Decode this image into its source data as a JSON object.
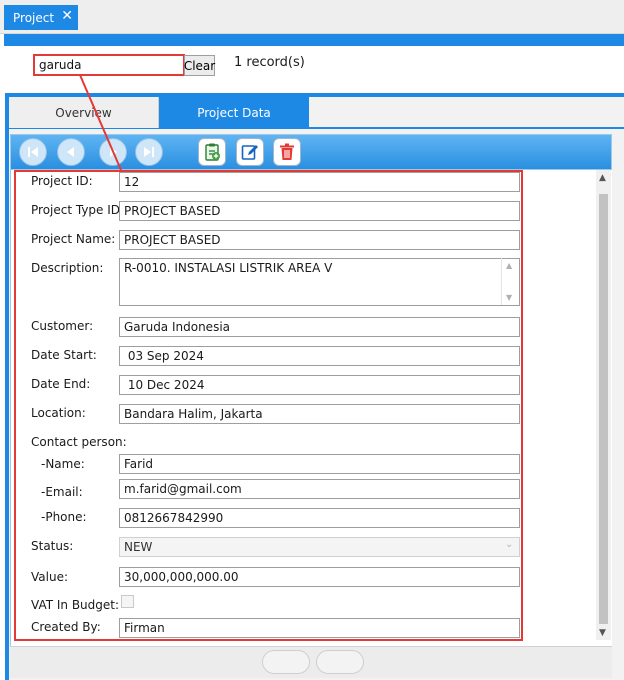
{
  "tab": {
    "title": "Project",
    "close_glyph": "✕"
  },
  "search": {
    "value": "garuda",
    "clear_label": "Clear",
    "record_count": "1 record(s)"
  },
  "subtabs": [
    {
      "label": "Overview",
      "active": false
    },
    {
      "label": "Project Data",
      "active": true
    }
  ],
  "toolbar": {
    "nav": [
      "first-icon",
      "previous-icon",
      "next-icon",
      "last-icon"
    ],
    "actions": [
      "add-document-icon",
      "edit-icon",
      "delete-icon"
    ]
  },
  "form": {
    "project_id": {
      "label": "Project ID:",
      "value": "12"
    },
    "project_type_id": {
      "label": "Project Type ID:",
      "value": "PROJECT BASED"
    },
    "project_name": {
      "label": "Project Name:",
      "value": "PROJECT BASED"
    },
    "description": {
      "label": "Description:",
      "value": "R-0010. INSTALASI LISTRIK AREA V"
    },
    "customer": {
      "label": "Customer:",
      "value": "Garuda Indonesia"
    },
    "date_start": {
      "label": "Date Start:",
      "value": " 03 Sep 2024"
    },
    "date_end": {
      "label": "Date End:",
      "value": " 10 Dec 2024"
    },
    "location": {
      "label": "Location:",
      "value": "Bandara Halim, Jakarta"
    },
    "contact_person": {
      "label": "Contact person:"
    },
    "contact_name": {
      "label": "-Name:",
      "value": "Farid"
    },
    "contact_email": {
      "label": "-Email:",
      "value": "m.farid@gmail.com"
    },
    "contact_phone": {
      "label": "-Phone:",
      "value": "0812667842990"
    },
    "status": {
      "label": "Status:",
      "value": " NEW"
    },
    "value": {
      "label": "Value:",
      "value": "30,000,000,000.00"
    },
    "vat_in_budget": {
      "label": "VAT In Budget:",
      "checked": false
    },
    "created_by": {
      "label": "Created By:",
      "value": "Firman"
    }
  },
  "colors": {
    "accent": "#1e88e5",
    "highlight": "#e53935"
  }
}
